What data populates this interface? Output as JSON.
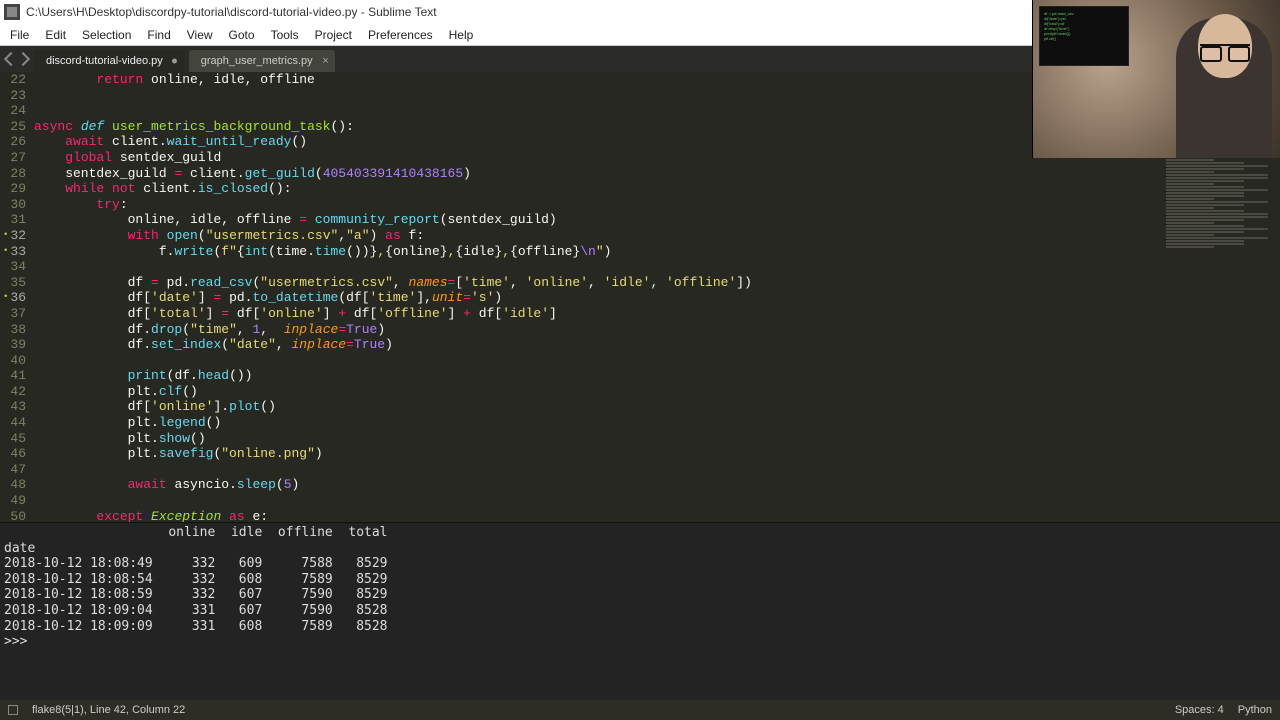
{
  "window": {
    "title": "C:\\Users\\H\\Desktop\\discordpy-tutorial\\discord-tutorial-video.py - Sublime Text"
  },
  "menu": [
    "File",
    "Edit",
    "Selection",
    "Find",
    "View",
    "Goto",
    "Tools",
    "Project",
    "Preferences",
    "Help"
  ],
  "tabs": [
    {
      "label": "discord-tutorial-video.py",
      "active": true,
      "dirty": true
    },
    {
      "label": "graph_user_metrics.py",
      "active": false,
      "dirty": false
    }
  ],
  "code": {
    "first_line": 22,
    "lines": [
      {
        "n": 22,
        "html": "        <span class='kw'>return</span> online, idle, offline"
      },
      {
        "n": 23,
        "html": ""
      },
      {
        "n": 24,
        "html": ""
      },
      {
        "n": 25,
        "html": "<span class='kw'>async</span> <span class='st'>def</span> <span class='nm'>user_metrics_background_task</span>():"
      },
      {
        "n": 26,
        "html": "    <span class='kw'>await</span> client.<span class='fn'>wait_until_ready</span>()"
      },
      {
        "n": 27,
        "html": "    <span class='kw'>global</span> sentdex_guild"
      },
      {
        "n": 28,
        "html": "    sentdex_guild <span class='op'>=</span> client.<span class='fn'>get_guild</span>(<span class='num'>405403391410438165</span>)"
      },
      {
        "n": 29,
        "html": "    <span class='kw'>while</span> <span class='kw'>not</span> client.<span class='fn'>is_closed</span>():"
      },
      {
        "n": 30,
        "html": "        <span class='kw'>try</span>:"
      },
      {
        "n": 31,
        "html": "            online, idle, offline <span class='op'>=</span> <span class='fn'>community_report</span>(sentdex_guild)"
      },
      {
        "n": 32,
        "mark": true,
        "html": "            <span class='kw'>with</span> <span class='fn'>open</span>(<span class='str'>\"usermetrics.csv\"</span>,<span class='str'>\"a\"</span>) <span class='kw'>as</span> f:"
      },
      {
        "n": 33,
        "mark": true,
        "html": "                f.<span class='fn'>write</span>(<span class='str'>f\"</span>{<span class='fn'>int</span>(time.<span class='fn'>time</span>())}<span class='str'>,</span>{online}<span class='str'>,</span>{idle}<span class='str'>,</span>{offline}<span class='esc'>\\n</span><span class='str'>\"</span>)"
      },
      {
        "n": 34,
        "html": ""
      },
      {
        "n": 35,
        "html": "            df <span class='op'>=</span> pd.<span class='fn'>read_csv</span>(<span class='str'>\"usermetrics.csv\"</span>, <span class='arg'>names</span><span class='op'>=</span>[<span class='str'>'time'</span>, <span class='str'>'online'</span>, <span class='str'>'idle'</span>, <span class='str'>'offline'</span>])"
      },
      {
        "n": 36,
        "mark": true,
        "html": "            df[<span class='str'>'date'</span>] <span class='op'>=</span> pd.<span class='fn'>to_datetime</span>(df[<span class='str'>'time'</span>],<span class='arg'>unit</span><span class='op'>=</span><span class='str'>'s'</span>)"
      },
      {
        "n": 37,
        "html": "            df[<span class='str'>'total'</span>] <span class='op'>=</span> df[<span class='str'>'online'</span>] <span class='op'>+</span> df[<span class='str'>'offline'</span>] <span class='op'>+</span> df[<span class='str'>'idle'</span>]"
      },
      {
        "n": 38,
        "html": "            df.<span class='fn'>drop</span>(<span class='str'>\"time\"</span>, <span class='num'>1</span>,  <span class='arg'>inplace</span><span class='op'>=</span><span class='const'>True</span>)"
      },
      {
        "n": 39,
        "html": "            df.<span class='fn'>set_index</span>(<span class='str'>\"date\"</span>, <span class='arg'>inplace</span><span class='op'>=</span><span class='const'>True</span>)"
      },
      {
        "n": 40,
        "html": ""
      },
      {
        "n": 41,
        "html": "            <span class='fn'>print</span>(df.<span class='fn'>head</span>())"
      },
      {
        "n": 42,
        "html": "            plt.<span class='fn'>clf</span>()"
      },
      {
        "n": 43,
        "html": "            df[<span class='str'>'online'</span>].<span class='fn'>plot</span>()"
      },
      {
        "n": 44,
        "html": "            plt.<span class='fn'>legend</span>()"
      },
      {
        "n": 45,
        "html": "            plt.<span class='fn'>show</span>()"
      },
      {
        "n": 46,
        "html": "            plt.<span class='fn'>savefig</span>(<span class='str'>\"online.png\"</span>)"
      },
      {
        "n": 47,
        "html": ""
      },
      {
        "n": 48,
        "html": "            <span class='kw'>await</span> asyncio.<span class='fn'>sleep</span>(<span class='num'>5</span>)"
      },
      {
        "n": 49,
        "html": ""
      },
      {
        "n": 50,
        "html": "        <span class='kw'>except</span> <span class='cls'>Exception</span> <span class='kw'>as</span> e:"
      }
    ]
  },
  "console": {
    "text": "                     online  idle  offline  total\ndate\n2018-10-12 18:08:49     332   609     7588   8529\n2018-10-12 18:08:54     332   608     7589   8529\n2018-10-12 18:08:59     332   607     7590   8529\n2018-10-12 18:09:04     331   607     7590   8528\n2018-10-12 18:09:09     331   608     7589   8528\n>>> "
  },
  "status": {
    "left1": "flake8(5|1), Line 42, Column 22",
    "spaces": "Spaces: 4",
    "lang": "Python"
  }
}
